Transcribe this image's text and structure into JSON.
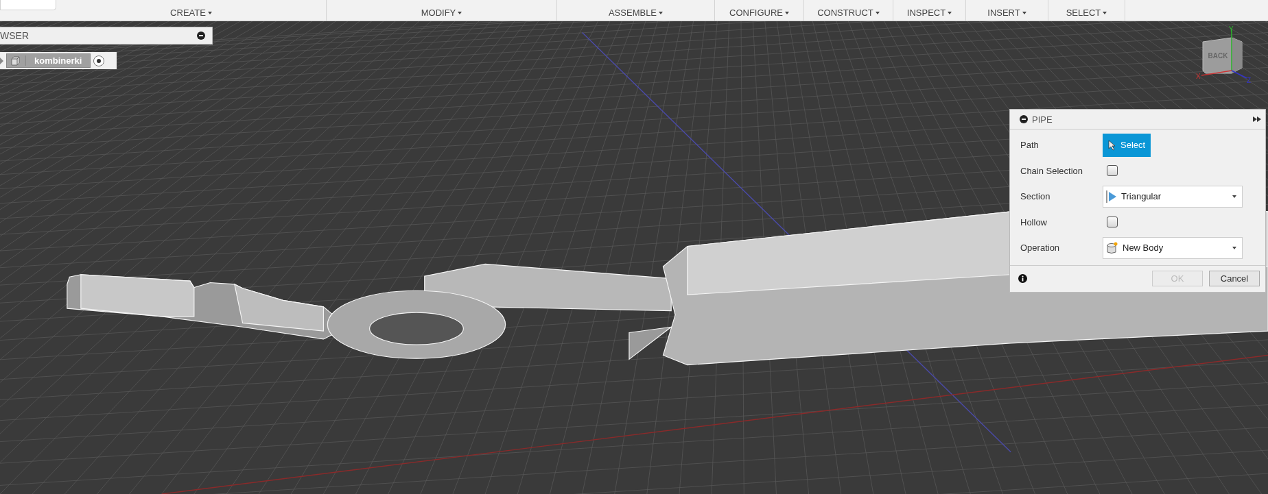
{
  "toolbar": {
    "groups": [
      {
        "label": "CREATE"
      },
      {
        "label": "MODIFY"
      },
      {
        "label": "ASSEMBLE"
      },
      {
        "label": "CONFIGURE"
      },
      {
        "label": "CONSTRUCT"
      },
      {
        "label": "INSPECT"
      },
      {
        "label": "INSERT"
      },
      {
        "label": "SELECT"
      }
    ]
  },
  "browser": {
    "title": "WSER",
    "items": [
      {
        "label": "kombinerki"
      }
    ]
  },
  "pipe_dialog": {
    "title": "PIPE",
    "rows": [
      {
        "kind": "button",
        "label": "Path",
        "value": "Select"
      },
      {
        "kind": "checkbox",
        "label": "Chain Selection",
        "checked": false
      },
      {
        "kind": "dropdown",
        "label": "Section",
        "value": "Triangular"
      },
      {
        "kind": "checkbox",
        "label": "Hollow",
        "checked": false
      },
      {
        "kind": "dropdown",
        "label": "Operation",
        "value": "New Body"
      }
    ],
    "buttons": [
      {
        "label": "OK",
        "disabled": true
      },
      {
        "label": "Cancel",
        "disabled": false
      }
    ]
  },
  "view_cube": {
    "face": "BACK",
    "axes": [
      "X",
      "Y",
      "Z"
    ]
  }
}
